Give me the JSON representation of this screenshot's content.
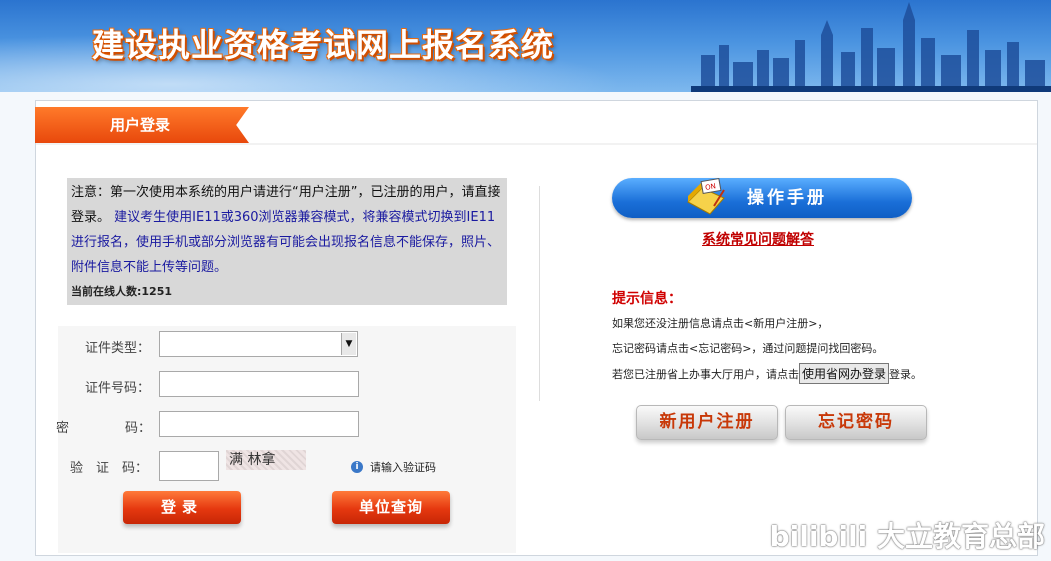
{
  "header": {
    "title": "建设执业资格考试网上报名系统"
  },
  "login_tab": {
    "label": "用户登录"
  },
  "notice": {
    "part1": "注意：第一次使用本系统的用户请进行“用户注册”，已注册的用户，请直接登录。",
    "part2": "建议考生使用IE11或360浏览器兼容模式，将兼容模式切换到IE11进行报名，使用手机或部分浏览器有可能会出现报名信息不能保存，照片、附件信息不能上传等问题。",
    "online_label": "当前在线人数:",
    "online_count": "1251"
  },
  "form": {
    "id_type_label": "证件类型：",
    "id_number_label": "证件号码：",
    "password_label_a": "密",
    "password_label_b": "码：",
    "captcha_label": "验　证　码：",
    "captcha_text": "满 林拿",
    "captcha_hint": "请输入验证码",
    "login_button": "登录",
    "unit_query_button": "单位查询"
  },
  "manual": {
    "label": "操作手册",
    "faq_link": "系统常见问题解答"
  },
  "tips": {
    "title": "提示信息：",
    "line1": "如果您还没注册信息请点击<新用户注册>，",
    "line2": "忘记密码请点击<忘记密码>，通过问题提问找回密码。",
    "line3_pre": "若您已注册省上办事大厅用户，请点击",
    "line3_button": "使用省网办登录",
    "line3_post": "登录。"
  },
  "buttons": {
    "register": "新用户注册",
    "forgot": "忘记密码"
  },
  "watermark": "bilibili 大立教育总部",
  "colors": {
    "accent_orange": "#e8480c",
    "accent_blue": "#1a6fd8",
    "tip_red": "#d00000"
  }
}
